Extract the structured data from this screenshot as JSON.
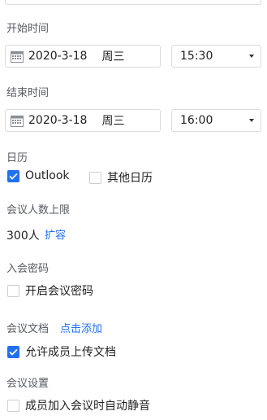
{
  "start_time": {
    "label": "开始时间",
    "date": "2020-3-18",
    "weekday": "周三",
    "time": "15:30"
  },
  "end_time": {
    "label": "结束时间",
    "date": "2020-3-18",
    "weekday": "周三",
    "time": "16:00"
  },
  "calendar": {
    "label": "日历",
    "options": [
      {
        "label": "Outlook",
        "checked": true
      },
      {
        "label": "其他日历",
        "checked": false
      }
    ]
  },
  "capacity": {
    "label": "会议人数上限",
    "value": "300人",
    "expand_link": "扩容"
  },
  "password": {
    "label": "入会密码",
    "option_label": "开启会议密码",
    "checked": false
  },
  "documents": {
    "label": "会议文档",
    "add_link": "点击添加",
    "option_label": "允许成员上传文档",
    "checked": true
  },
  "settings": {
    "label": "会议设置",
    "option_label": "成员加入会议时自动静音",
    "checked": false
  },
  "colors": {
    "accent": "#1f70f2",
    "label_gray": "#555a62",
    "border": "#d8dbe0"
  },
  "icons": {
    "calendar": "calendar-icon",
    "dropdown": "caret-down-icon",
    "check": "check-icon"
  }
}
